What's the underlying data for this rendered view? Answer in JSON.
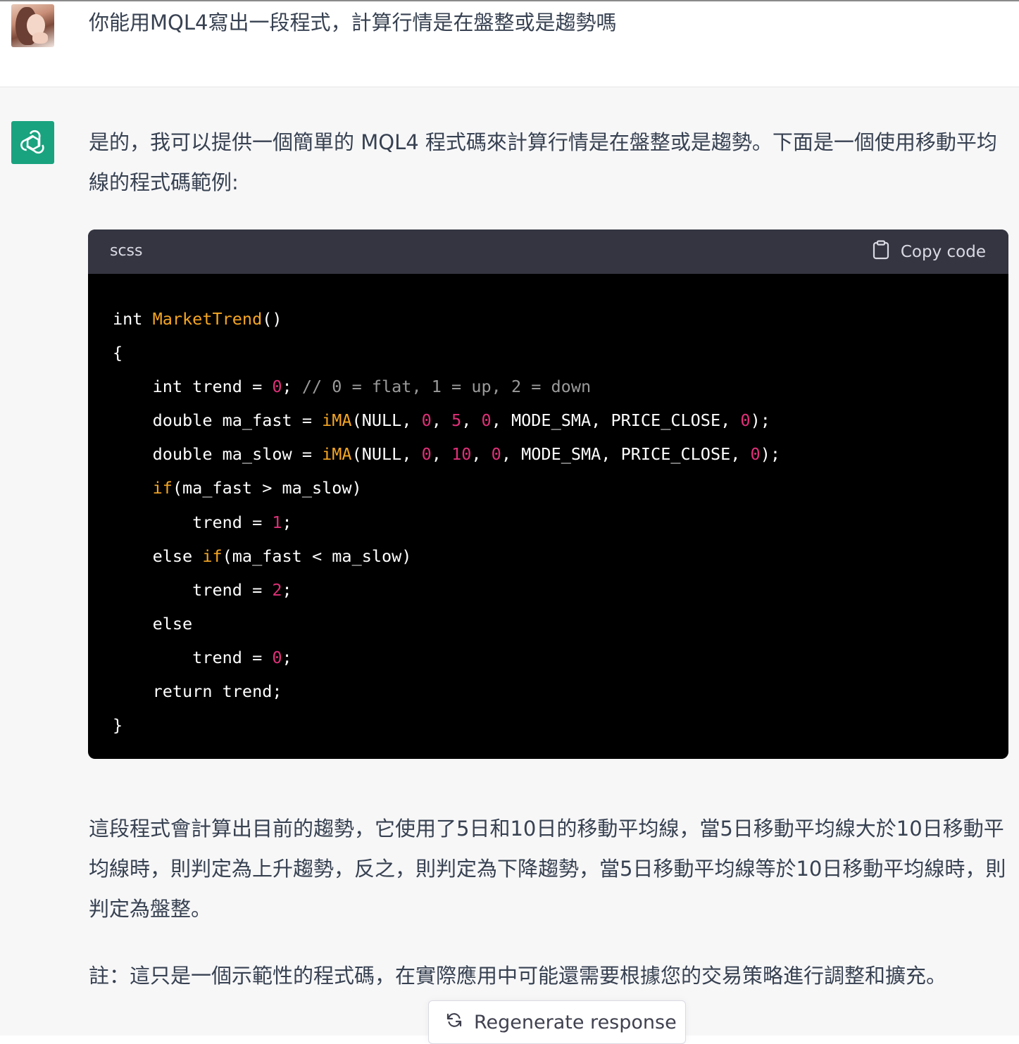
{
  "user_message": {
    "avatar": "user-avatar",
    "text": "你能用MQL4寫出一段程式，計算行情是在盤整或是趨勢嗎"
  },
  "assistant_message": {
    "avatar": "openai-logo-icon",
    "intro": "是的，我可以提供一個簡單的 MQL4 程式碼來計算行情是在盤整或是趨勢。下面是一個使用移動平均線的程式碼範例:",
    "code_block": {
      "language": "scss",
      "copy_label": "Copy code",
      "lines": [
        "int MarketTrend()",
        "{",
        "    int trend = 0; // 0 = flat, 1 = up, 2 = down",
        "    double ma_fast = iMA(NULL, 0, 5, 0, MODE_SMA, PRICE_CLOSE, 0);",
        "    double ma_slow = iMA(NULL, 0, 10, 0, MODE_SMA, PRICE_CLOSE, 0);",
        "    if(ma_fast > ma_slow)",
        "        trend = 1;",
        "    else if(ma_fast < ma_slow)",
        "        trend = 2;",
        "    else",
        "        trend = 0;",
        "    return trend;",
        "}"
      ]
    },
    "explanation": "這段程式會計算出目前的趨勢，它使用了5日和10日的移動平均線，當5日移動平均線大於10日移動平均線時，則判定為上升趨勢，反之，則判定為下降趨勢，當5日移動平均線等於10日移動平均線時，則判定為盤整。",
    "note": "註：這只是一個示範性的程式碼，在實際應用中可能還需要根據您的交易策略進行調整和擴充。"
  },
  "regenerate_label": "Regenerate response",
  "colors": {
    "code_bg": "#000000",
    "code_header_bg": "#343541",
    "function": "#f5a623",
    "number": "#df3079",
    "comment": "#9a9a9a",
    "assistant_bg": "#f7f7f8",
    "gpt_green": "#19a37f"
  }
}
